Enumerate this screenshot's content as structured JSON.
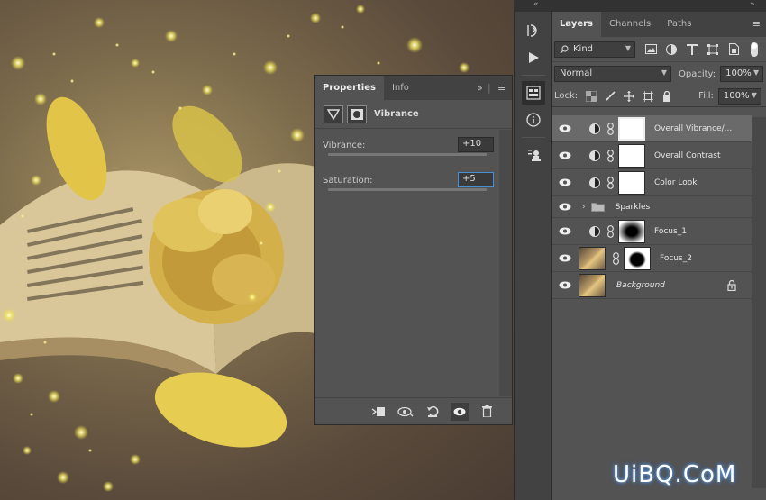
{
  "properties_panel": {
    "tabs": [
      {
        "label": "Properties"
      },
      {
        "label": "Info"
      }
    ],
    "collapse_glyph": "»",
    "adjustment_title": "Vibrance",
    "vibrance": {
      "label": "Vibrance:",
      "value": "+10",
      "slider_fraction": 0.55
    },
    "saturation": {
      "label": "Saturation:",
      "value": "+5",
      "slider_fraction": 0.51
    }
  },
  "layers_panel": {
    "tabs": [
      {
        "label": "Layers"
      },
      {
        "label": "Channels"
      },
      {
        "label": "Paths"
      }
    ],
    "filter_kind": "Kind",
    "blend_mode": "Normal",
    "opacity_label": "Opacity:",
    "opacity_value": "100%",
    "lock_label": "Lock:",
    "fill_label": "Fill:",
    "fill_value": "100%",
    "layers": [
      {
        "name": "Overall Vibrance/...",
        "type": "adjustment",
        "selected": true
      },
      {
        "name": "Overall Contrast",
        "type": "adjustment"
      },
      {
        "name": "Color Look",
        "type": "adjustment"
      },
      {
        "name": "Sparkles",
        "type": "group"
      },
      {
        "name": "Focus_1",
        "type": "adjustment"
      },
      {
        "name": "Focus_2",
        "type": "image"
      },
      {
        "name": "Background",
        "type": "background",
        "locked": true
      }
    ]
  },
  "watermark": "UiBQ.CoM",
  "colors": {
    "panel": "#535353",
    "dark": "#424242",
    "accent": "#4a8ed8"
  }
}
